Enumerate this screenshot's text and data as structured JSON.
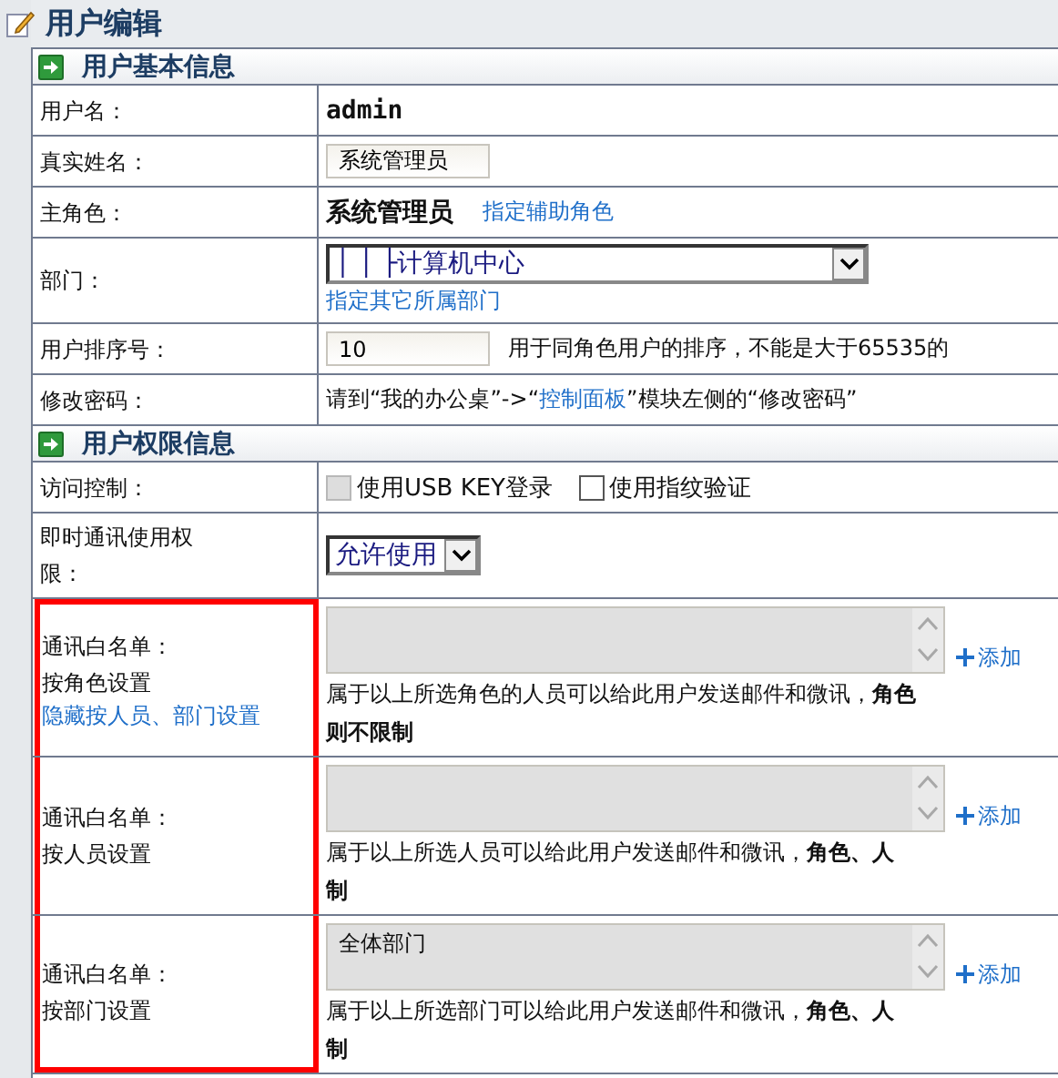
{
  "page_title": "用户编辑",
  "sections": [
    {
      "title": "用户基本信息",
      "rows": [
        {
          "kind": "plain",
          "label": "用户名：",
          "value": "admin"
        },
        {
          "kind": "input",
          "label": "真实姓名：",
          "value": "系统管理员"
        },
        {
          "kind": "role",
          "label": "主角色：",
          "value": "系统管理员",
          "link": "指定辅助角色"
        },
        {
          "kind": "select",
          "label": "部门：",
          "value": "│ │ ├计算机中心",
          "link": "指定其它所属部门"
        },
        {
          "kind": "input",
          "label": "用户排序号：",
          "value": "10",
          "note": "用于同角色用户的排序，不能是大于65535的"
        },
        {
          "kind": "sentence",
          "label": "修改密码：",
          "parts": [
            {
              "text": "请到“我的办公桌”->“",
              "link": false
            },
            {
              "text": "控制面板",
              "link": true
            },
            {
              "text": "”模块左侧的“修改密码”",
              "link": false
            }
          ]
        }
      ]
    },
    {
      "title": "用户权限信息",
      "rows": [
        {
          "kind": "checks",
          "label": "访问控制：",
          "checks": [
            {
              "label": "使用USB KEY登录",
              "checked": false,
              "disabled": true
            },
            {
              "label": "使用指纹验证",
              "checked": false,
              "disabled": false
            }
          ]
        },
        {
          "kind": "small_select",
          "label": "即时通讯使用权限：",
          "value": "允许使用"
        },
        {
          "kind": "whitelist",
          "highlighted": true,
          "label_lines": [
            "通讯白名单：",
            "按角色设置"
          ],
          "link": "隐藏按人员、部门设置",
          "items": [],
          "add": "添加",
          "note_lines": [
            "属于以上所选角色的人员可以给此用户发送邮件和微讯，**角色**",
            "**则不限制**"
          ]
        },
        {
          "kind": "whitelist",
          "highlighted": true,
          "label_lines": [
            "通讯白名单：",
            "按人员设置"
          ],
          "items": [],
          "add": "添加",
          "note_lines": [
            "属于以上所选人员可以给此用户发送邮件和微讯，**角色、人**",
            "**制**"
          ]
        },
        {
          "kind": "whitelist",
          "highlighted": true,
          "label_lines": [
            "通讯白名单：",
            "按部门设置"
          ],
          "items": [
            "全体部门"
          ],
          "add": "添加",
          "note_lines": [
            "属于以上所选部门可以给此用户发送邮件和微讯，**角色、人**",
            "**制**"
          ]
        }
      ]
    }
  ]
}
